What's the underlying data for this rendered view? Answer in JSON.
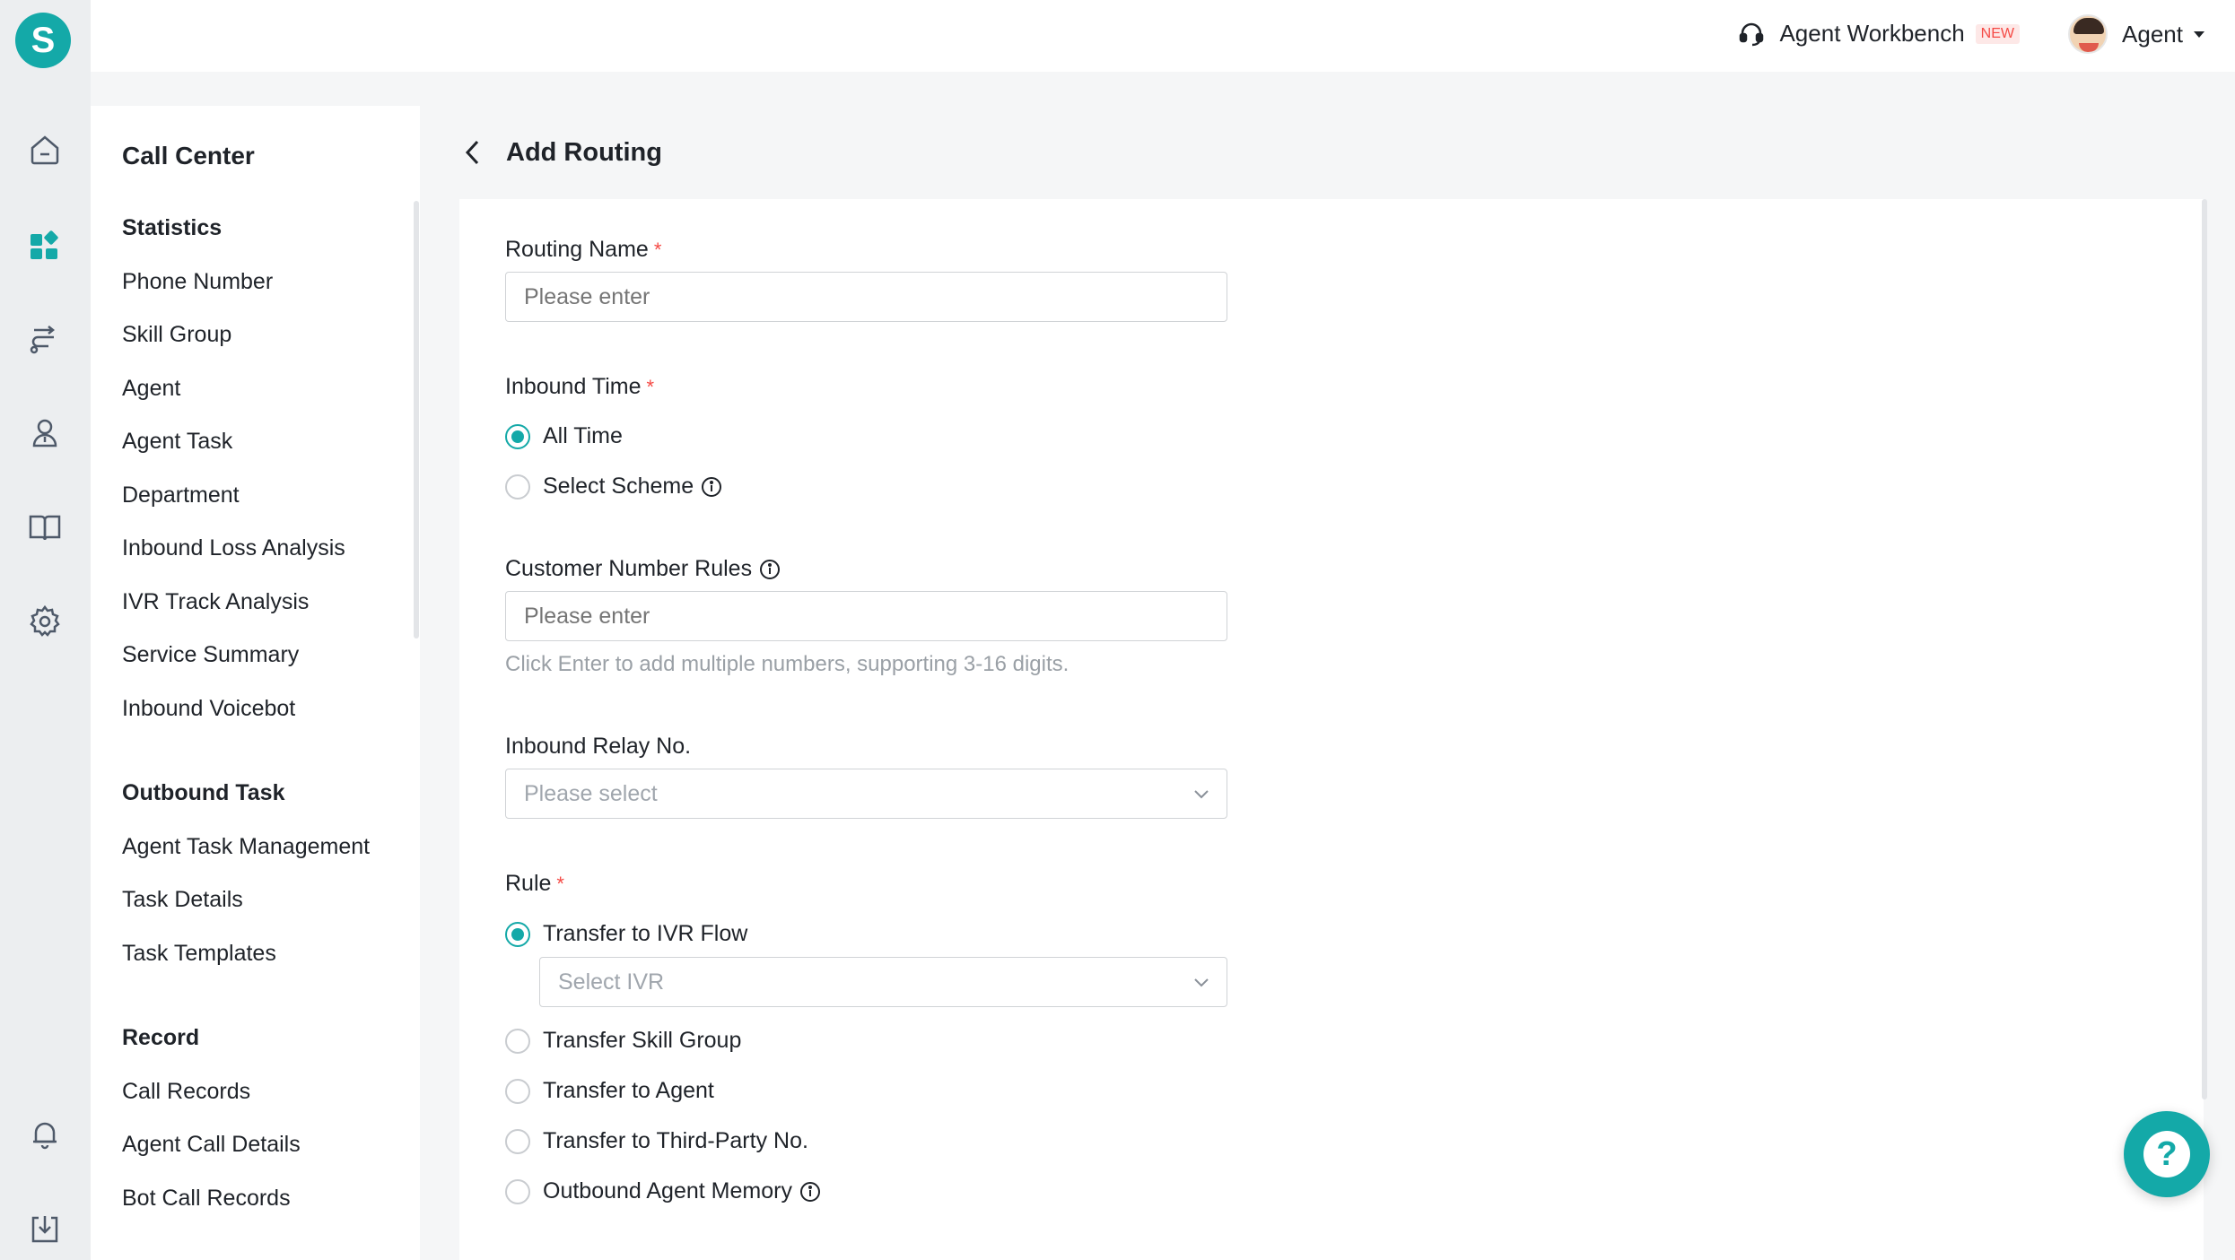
{
  "header": {
    "logo_letter": "S",
    "workbench_label": "Agent Workbench",
    "new_badge": "NEW",
    "user_label": "Agent"
  },
  "rail": {
    "icons": [
      "home-icon",
      "dashboard-icon",
      "routing-icon",
      "user-icon",
      "book-icon",
      "settings-icon",
      "bell-icon",
      "download-icon"
    ]
  },
  "sidebar": {
    "title": "Call Center",
    "groups": [
      {
        "title": "Statistics",
        "items": [
          "Phone Number",
          "Skill Group",
          "Agent",
          "Agent Task",
          "Department",
          "Inbound Loss Analysis",
          "IVR Track Analysis",
          "Service Summary",
          "Inbound Voicebot"
        ]
      },
      {
        "title": "Outbound Task",
        "items": [
          "Agent Task Management",
          "Task Details",
          "Task Templates"
        ]
      },
      {
        "title": "Record",
        "items": [
          "Call Records",
          "Agent Call Details",
          "Bot Call Records"
        ]
      }
    ]
  },
  "page": {
    "title": "Add Routing"
  },
  "form": {
    "routing_name": {
      "label": "Routing Name",
      "required": "*",
      "placeholder": "Please enter"
    },
    "inbound_time": {
      "label": "Inbound Time",
      "required": "*",
      "options": [
        "All Time",
        "Select Scheme"
      ],
      "selected": "All Time"
    },
    "customer_number_rules": {
      "label": "Customer Number Rules",
      "placeholder": "Please enter",
      "hint": "Click Enter to add multiple numbers, supporting 3-16 digits."
    },
    "inbound_relay": {
      "label": "Inbound Relay No.",
      "placeholder": "Please select"
    },
    "rule": {
      "label": "Rule",
      "required": "*",
      "options": [
        "Transfer to IVR Flow",
        "Transfer Skill Group",
        "Transfer to Agent",
        "Transfer to Third-Party No.",
        "Outbound Agent Memory"
      ],
      "selected": "Transfer to IVR Flow",
      "ivr_placeholder": "Select IVR"
    }
  },
  "help": {
    "symbol": "?"
  },
  "colors": {
    "accent": "#14a9a8",
    "required": "#f54a45"
  }
}
